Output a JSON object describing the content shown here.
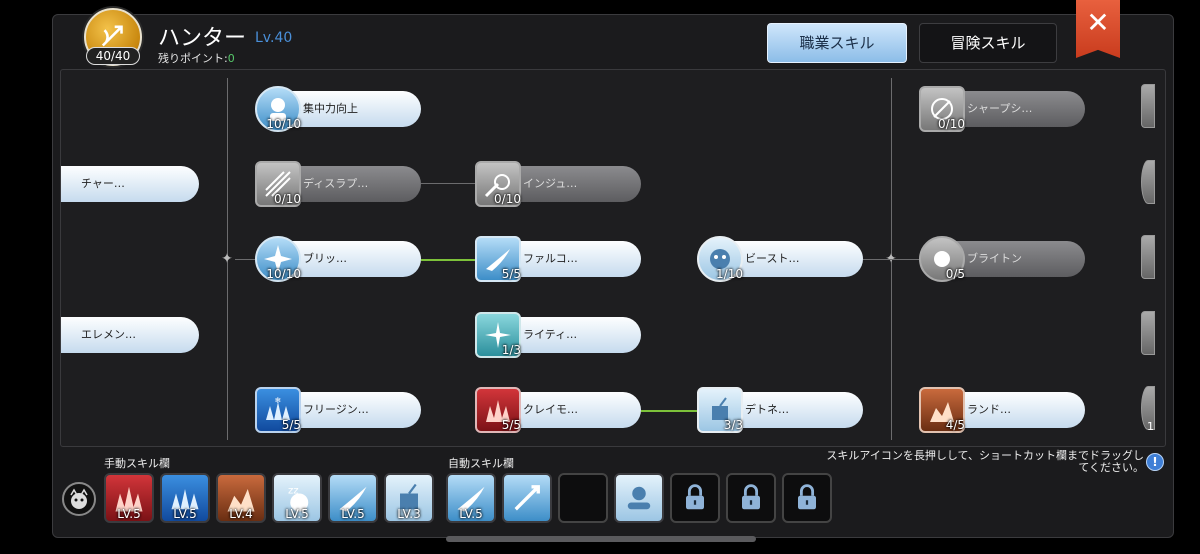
{
  "header": {
    "job_name": "ハンター",
    "level": "Lv.40",
    "job_level_badge": "40/40",
    "points_label": "残りポイント:",
    "points_value": "0",
    "tab_job": "職業スキル",
    "tab_adventure": "冒険スキル",
    "close": "✕"
  },
  "tree": {
    "left_partial": [
      "チャー…",
      "エレメン…"
    ],
    "skills": [
      {
        "name": "集中力向上",
        "count": "10/10"
      },
      {
        "name": "ディスラプ…",
        "count": "0/10"
      },
      {
        "name": "インジュ…",
        "count": "0/10"
      },
      {
        "name": "ブリッ…",
        "count": "10/10"
      },
      {
        "name": "ファルコ…",
        "count": "5/5"
      },
      {
        "name": "ビースト…",
        "count": "1/10"
      },
      {
        "name": "ライティ…",
        "count": "1/3"
      },
      {
        "name": "フリージン…",
        "count": "5/5"
      },
      {
        "name": "クレイモ…",
        "count": "5/5"
      },
      {
        "name": "デトネ…",
        "count": "3/3"
      },
      {
        "name": "シャープシ…",
        "count": "0/10"
      },
      {
        "name": "ブライトン",
        "count": "0/5"
      },
      {
        "name": "ランド…",
        "count": "4/5"
      }
    ],
    "right_partial_count": "1"
  },
  "bottom": {
    "manual_label": "手動スキル欄",
    "auto_label": "自動スキル欄",
    "hint": "スキルアイコンを長押しして、ショートカット欄までドラッグしてください。",
    "hint_icon": "!",
    "manual_slots": [
      "LV.5",
      "LV.5",
      "LV.4",
      "LV.5",
      "LV.5",
      "LV.3"
    ],
    "auto_slots": [
      "LV.5",
      "",
      "",
      "",
      "",
      "",
      ""
    ]
  },
  "colors": {
    "accent_blue": "#4a8fd8",
    "points_green": "#56c86a",
    "link_green": "#7dc23a",
    "close_red": "#d9482a"
  }
}
